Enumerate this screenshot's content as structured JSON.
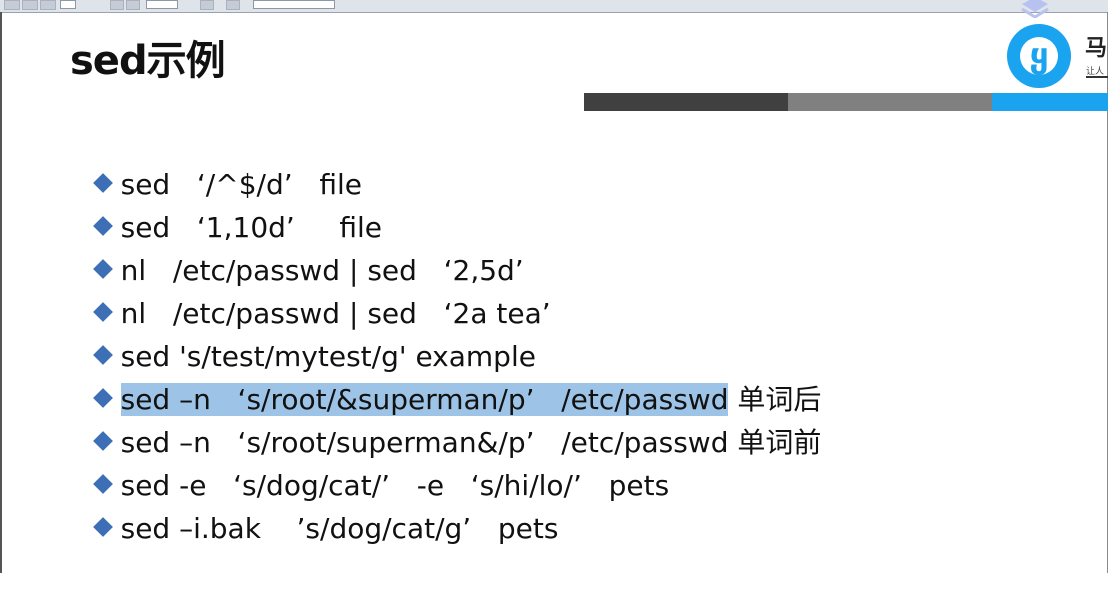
{
  "slide": {
    "title": "sed示例"
  },
  "logo": {
    "text": "马",
    "sub": "让人",
    "badge_color": "#1aa3ee"
  },
  "header_bars": [
    {
      "color": "#404040"
    },
    {
      "color": "#808080"
    },
    {
      "color": "#1aa3ee"
    }
  ],
  "commands": [
    {
      "text": "sed   ‘/^$/d’   file",
      "highlight": "",
      "suffix": ""
    },
    {
      "text": "sed   ‘1,10d’     file",
      "highlight": "",
      "suffix": ""
    },
    {
      "text": "nl   /etc/passwd | sed   ‘2,5d’",
      "highlight": "",
      "suffix": ""
    },
    {
      "text": "nl   /etc/passwd | sed   ‘2a tea’",
      "highlight": "",
      "suffix": ""
    },
    {
      "text": "sed 's/test/mytest/g' example",
      "highlight": "",
      "suffix": ""
    },
    {
      "text": "",
      "highlight": "sed –n   ‘s/root/&superman/p’   /etc/passwd",
      "suffix": " 单词后"
    },
    {
      "text": "sed –n   ‘s/root/superman&/p’   /etc/passwd 单词前",
      "highlight": "",
      "suffix": ""
    },
    {
      "text": "sed -e   ‘s/dog/cat/’   -e   ‘s/hi/lo/’   pets",
      "highlight": "",
      "suffix": ""
    },
    {
      "text": "sed –i.bak    ’s/dog/cat/g’   pets",
      "highlight": "",
      "suffix": ""
    }
  ],
  "colors": {
    "bullet": "#3c6fb6",
    "highlight": "#9dc3e6"
  }
}
